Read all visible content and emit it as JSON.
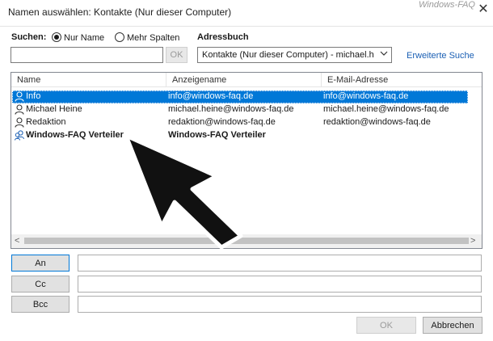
{
  "window": {
    "title": "Namen auswählen: Kontakte (Nur dieser Computer)",
    "watermark": "Windows-FAQ",
    "close_icon": "close-icon"
  },
  "search": {
    "label": "Suchen:",
    "option_name": "Nur Name",
    "option_more": "Mehr Spalten",
    "selected_option": "Nur Name",
    "value": "",
    "ok_label": "OK"
  },
  "addressbook": {
    "label": "Adressbuch",
    "selected": "Kontakte (Nur dieser Computer) - michael.h",
    "advanced_search": "Erweiterte Suche"
  },
  "list": {
    "columns": [
      "Name",
      "Anzeigename",
      "E-Mail-Adresse"
    ],
    "rows": [
      {
        "name": "Info",
        "display": "info@windows-faq.de",
        "email": "info@windows-faq.de",
        "icon": "contact-icon",
        "selected": true,
        "bold": false
      },
      {
        "name": "Michael Heine",
        "display": "michael.heine@windows-faq.de",
        "email": "michael.heine@windows-faq.de",
        "icon": "contact-icon",
        "selected": false,
        "bold": false
      },
      {
        "name": "Redaktion",
        "display": "redaktion@windows-faq.de",
        "email": "redaktion@windows-faq.de",
        "icon": "contact-icon",
        "selected": false,
        "bold": false
      },
      {
        "name": "Windows-FAQ Verteiler",
        "display": "Windows-FAQ Verteiler",
        "email": "",
        "icon": "distribution-list-icon",
        "selected": false,
        "bold": true
      }
    ],
    "scroll_left": "<",
    "scroll_right": ">"
  },
  "recipients": {
    "to_label": "An",
    "cc_label": "Cc",
    "bcc_label": "Bcc",
    "to_value": "",
    "cc_value": "",
    "bcc_value": ""
  },
  "footer": {
    "ok_label": "OK",
    "cancel_label": "Abbrechen"
  },
  "colors": {
    "selection": "#0078d7",
    "link": "#1a5fb4"
  }
}
